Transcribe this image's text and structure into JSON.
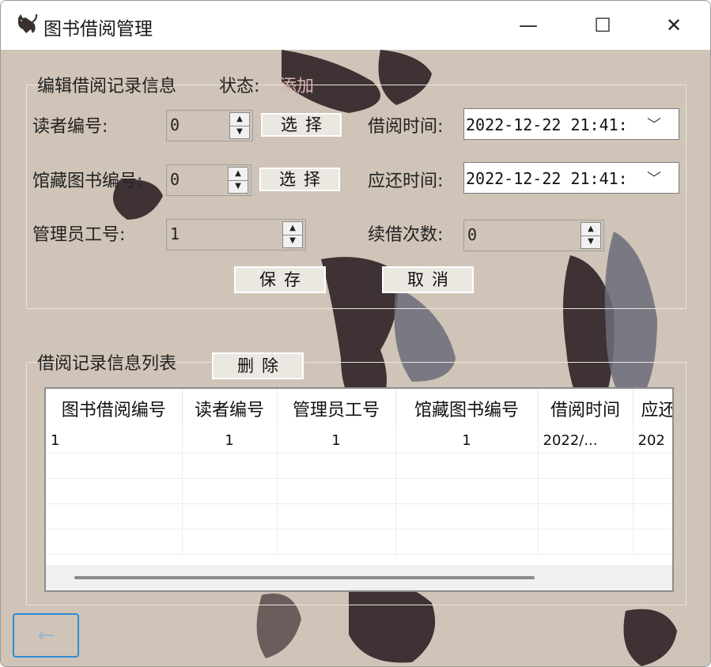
{
  "window": {
    "title": "图书借阅管理",
    "controls": {
      "minimize": "—",
      "maximize": "☐",
      "close": "✕"
    },
    "app_icon": "cat-icon"
  },
  "edit_group": {
    "title": "编辑借阅记录信息",
    "status_label": "状态:",
    "status_value": "添加",
    "reader_id": {
      "label": "读者编号:",
      "value": "0",
      "select_button": "选择"
    },
    "book_id": {
      "label": "馆藏图书编号:",
      "value": "0",
      "select_button": "选择"
    },
    "admin_id": {
      "label": "管理员工号:",
      "value": "1"
    },
    "borrow_time": {
      "label": "借阅时间:",
      "value": "2022-12-22 21:41:"
    },
    "return_time": {
      "label": "应还时间:",
      "value": "2022-12-22 21:41:"
    },
    "renew_count": {
      "label": "续借次数:",
      "value": "0"
    },
    "save_button": "保存",
    "cancel_button": "取消"
  },
  "list_group": {
    "title": "借阅记录信息列表",
    "delete_button": "删除",
    "columns": [
      "图书借阅编号",
      "读者编号",
      "管理员工号",
      "馆藏图书编号",
      "借阅时间",
      "应还"
    ],
    "rows": [
      [
        "1",
        "1",
        "1",
        "1",
        "2022/...",
        "202"
      ]
    ]
  },
  "back_button": "←"
}
